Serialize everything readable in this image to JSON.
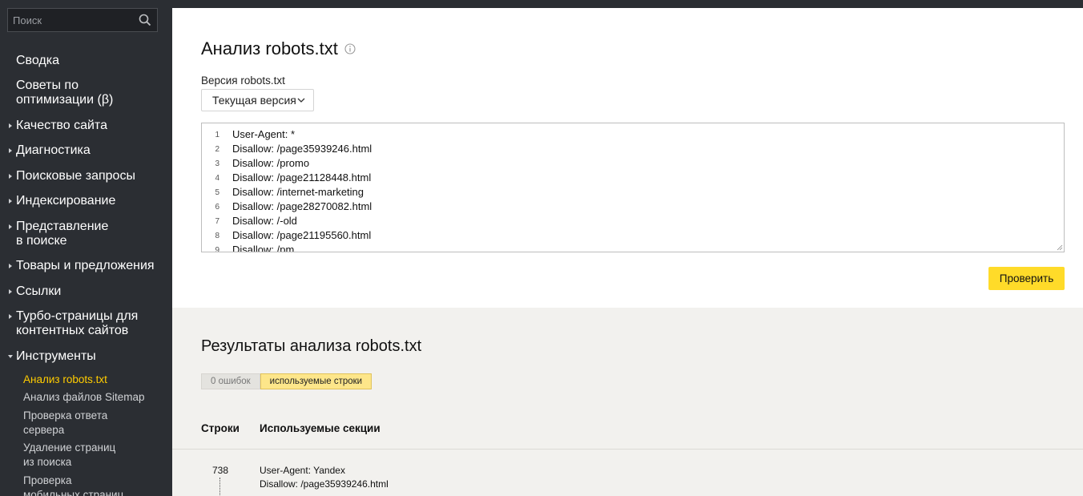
{
  "search": {
    "placeholder": "Поиск"
  },
  "sidebar": {
    "items": [
      {
        "label": "Сводка",
        "arrow": "none"
      },
      {
        "label": "Советы по",
        "label2": "оптимизации (β)",
        "arrow": "none"
      },
      {
        "label": "Качество сайта",
        "arrow": "right"
      },
      {
        "label": "Диагностика",
        "arrow": "right"
      },
      {
        "label": "Поисковые запросы",
        "arrow": "right"
      },
      {
        "label": "Индексирование",
        "arrow": "right"
      },
      {
        "label": "Представление",
        "label2": "в поиске",
        "arrow": "right"
      },
      {
        "label": "Товары и предложения",
        "arrow": "right"
      },
      {
        "label": "Ссылки",
        "arrow": "right"
      },
      {
        "label": "Турбо-страницы для",
        "label2": "контентных сайтов",
        "arrow": "right"
      },
      {
        "label": "Инструменты",
        "arrow": "down"
      }
    ],
    "subitems": [
      {
        "label": "Анализ robots.txt",
        "active": true
      },
      {
        "label": "Анализ файлов Sitemap"
      },
      {
        "label": "Проверка ответа",
        "label2": "сервера"
      },
      {
        "label": "Удаление страниц",
        "label2": "из поиска"
      },
      {
        "label": "Проверка",
        "label2": "мобильных страниц"
      }
    ]
  },
  "main": {
    "title": "Анализ robots.txt",
    "version_label": "Версия robots.txt",
    "version_value": "Текущая версия",
    "editor_lines": [
      {
        "num": "1",
        "text": "User-Agent: *"
      },
      {
        "num": "2",
        "text": "Disallow: /page35939246.html"
      },
      {
        "num": "3",
        "text": "Disallow: /promo"
      },
      {
        "num": "4",
        "text": "Disallow: /page21128448.html"
      },
      {
        "num": "5",
        "text": "Disallow: /internet-marketing"
      },
      {
        "num": "6",
        "text": "Disallow: /page28270082.html"
      },
      {
        "num": "7",
        "text": "Disallow: /-old"
      },
      {
        "num": "8",
        "text": "Disallow: /page21195560.html"
      },
      {
        "num": "9",
        "text": "Disallow: /pm"
      }
    ],
    "check_label": "Проверить"
  },
  "results": {
    "title": "Результаты анализа robots.txt",
    "tab_errors": "0 ошибок",
    "tab_used": "используемые строки",
    "col_lines": "Строки",
    "col_sections": "Используемые секции",
    "row": {
      "num": "738",
      "line1": "User-Agent: Yandex",
      "line2": "Disallow: /page35939246.html"
    }
  },
  "colors": {
    "sidebar_bg": "#2b2e33",
    "accent_yellow": "#ffdb29",
    "active_link": "#ffcc00"
  }
}
